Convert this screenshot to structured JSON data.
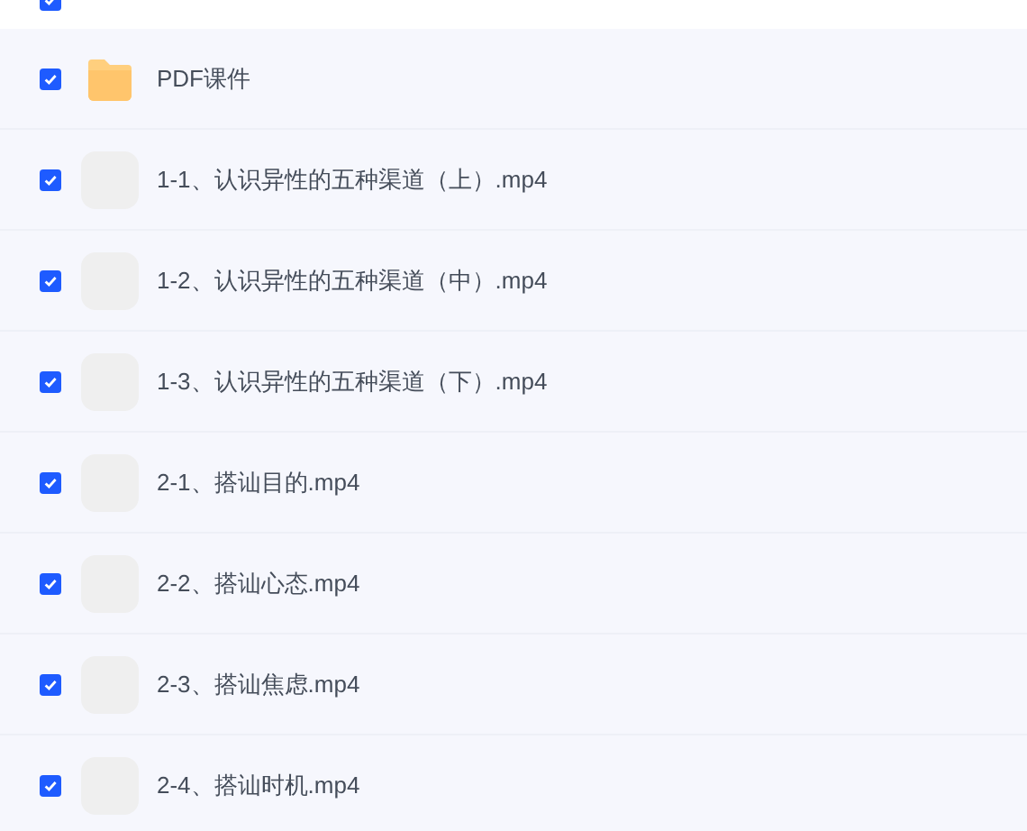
{
  "header": {
    "checked": true
  },
  "files": [
    {
      "name": "PDF课件",
      "kind": "folder",
      "checked": true
    },
    {
      "name": "1-1、认识异性的五种渠道（上）.mp4",
      "kind": "video",
      "checked": true
    },
    {
      "name": "1-2、认识异性的五种渠道（中）.mp4",
      "kind": "video",
      "checked": true
    },
    {
      "name": "1-3、认识异性的五种渠道（下）.mp4",
      "kind": "video",
      "checked": true
    },
    {
      "name": "2-1、搭讪目的.mp4",
      "kind": "video",
      "checked": true
    },
    {
      "name": "2-2、搭讪心态.mp4",
      "kind": "video",
      "checked": true
    },
    {
      "name": "2-3、搭讪焦虑.mp4",
      "kind": "video",
      "checked": true
    },
    {
      "name": "2-4、搭讪时机.mp4",
      "kind": "video",
      "checked": true
    }
  ]
}
